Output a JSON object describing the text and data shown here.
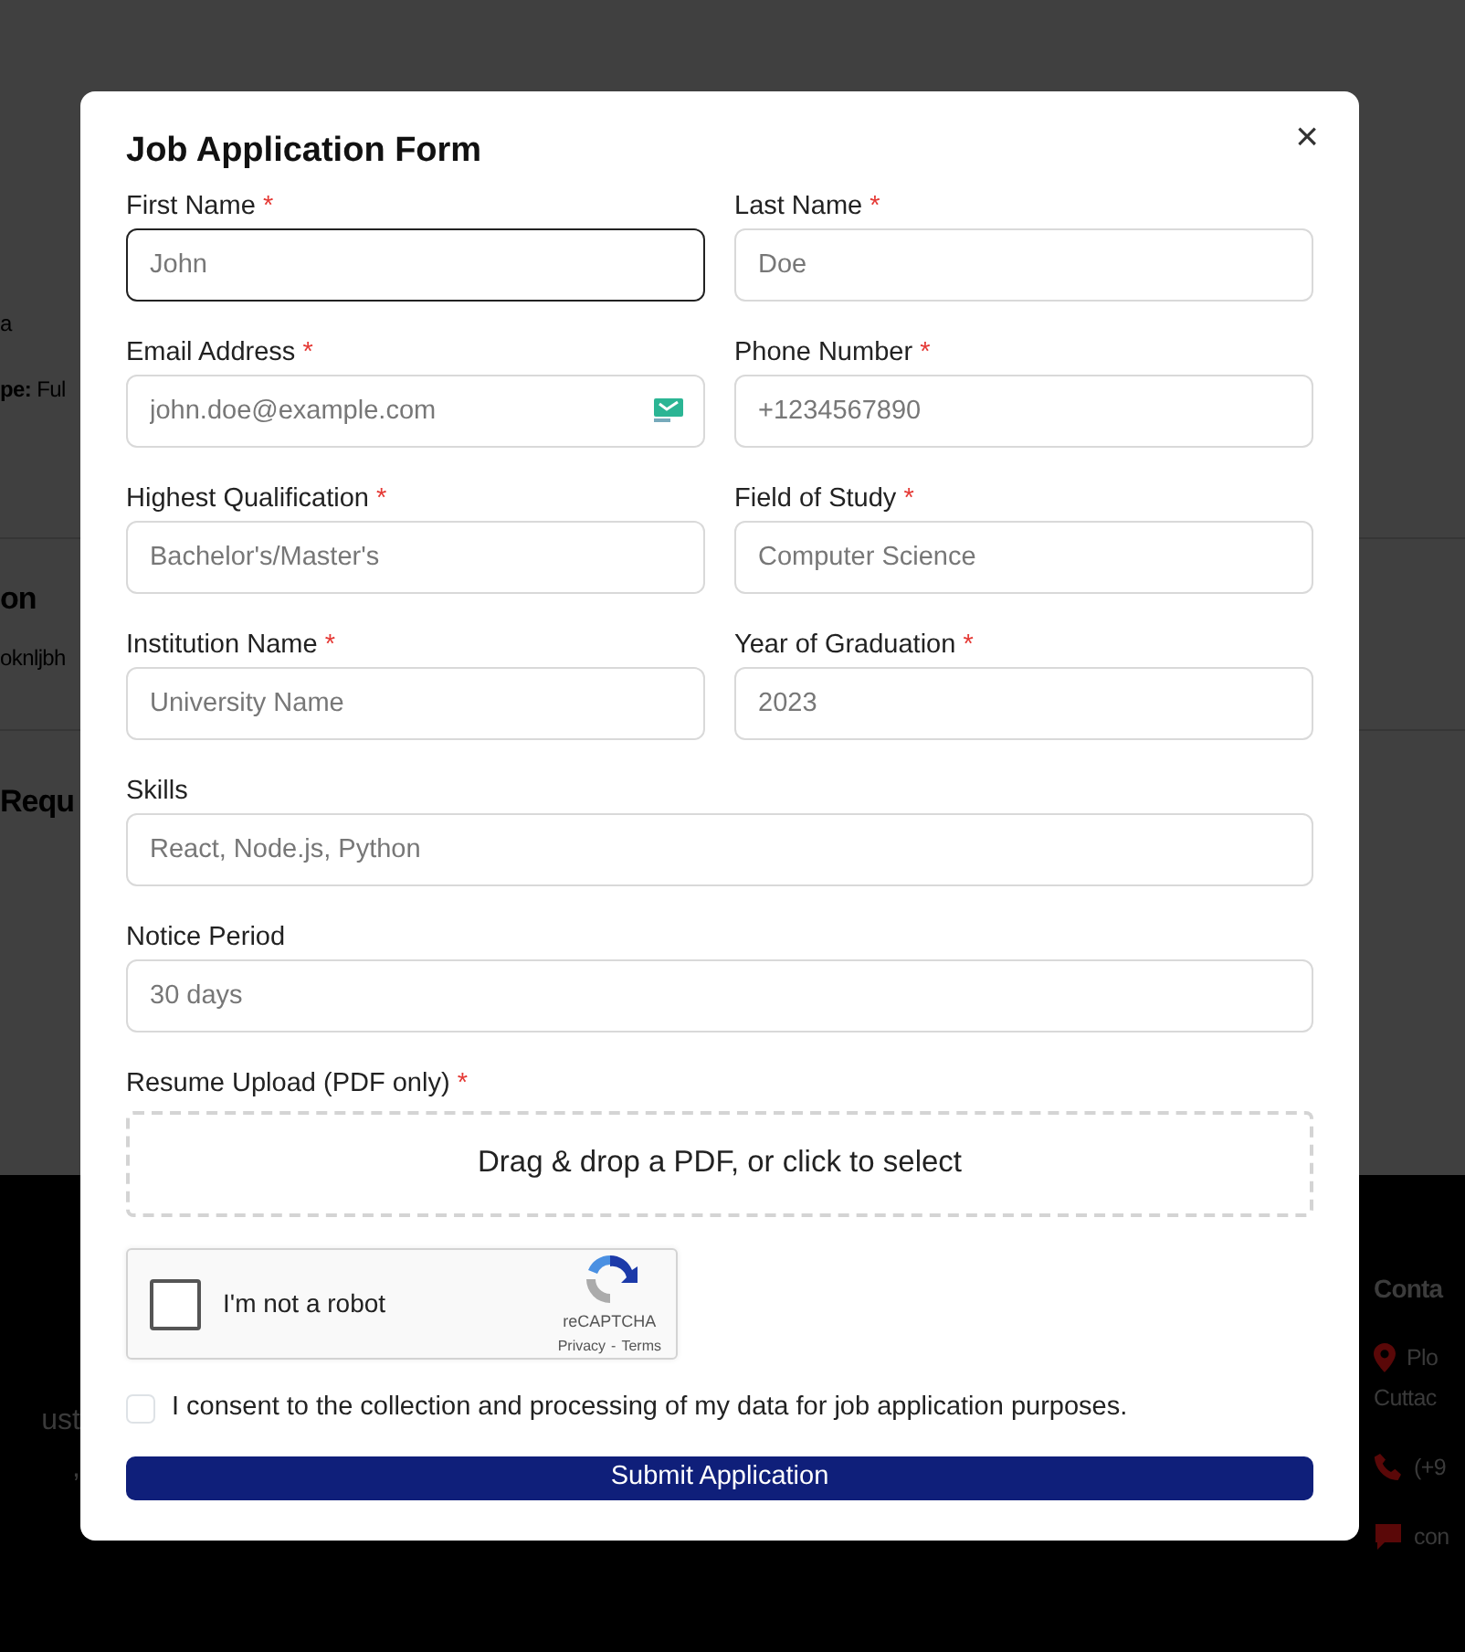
{
  "background_page": {
    "sections": [
      {
        "items": [
          {
            "kind": "text",
            "text": "a"
          },
          {
            "kind": "label_value",
            "label": "pe:",
            "value": "Ful"
          }
        ]
      },
      {
        "items": [
          {
            "kind": "heading",
            "text": "on"
          },
          {
            "kind": "text",
            "text": "oknljbh"
          }
        ]
      },
      {
        "items": [
          {
            "kind": "heading",
            "text": "Requ"
          }
        ]
      }
    ],
    "footer_left": [
      "ust",
      ","
    ],
    "contact": {
      "heading": "Conta",
      "items": [
        {
          "kind": "location",
          "lines": [
            "Plo",
            "Cuttac"
          ]
        },
        {
          "kind": "phone",
          "lines": [
            "(+9"
          ]
        },
        {
          "kind": "chat",
          "lines": [
            "con"
          ]
        }
      ]
    }
  },
  "modal": {
    "title": "Job Application Form",
    "close": "×",
    "rows": [
      [
        {
          "label": "First Name",
          "required_mark": "*",
          "placeholder": "John",
          "focused": true
        },
        {
          "label": "Last Name",
          "required_mark": "*",
          "placeholder": "Doe",
          "focused": false
        }
      ],
      [
        {
          "label": "Email Address",
          "required_mark": "*",
          "placeholder": "john.doe@example.com",
          "focused": false,
          "kind": "email"
        },
        {
          "label": "Phone Number",
          "required_mark": "*",
          "placeholder": "+1234567890",
          "focused": false
        }
      ],
      [
        {
          "label": "Highest Qualification",
          "required_mark": "*",
          "placeholder": "Bachelor's/Master's",
          "focused": false
        },
        {
          "label": "Field of Study",
          "required_mark": "*",
          "placeholder": "Computer Science",
          "focused": false
        }
      ],
      [
        {
          "label": "Institution Name",
          "required_mark": "*",
          "placeholder": "University Name",
          "focused": false
        },
        {
          "label": "Year of Graduation",
          "required_mark": "*",
          "placeholder": "2023",
          "focused": false
        }
      ],
      [
        {
          "label": "Skills",
          "placeholder": "React, Node.js, Python",
          "focused": false
        }
      ],
      [
        {
          "label": "Notice Period",
          "placeholder": "30 days",
          "focused": false
        }
      ]
    ],
    "resume": {
      "label": "Resume Upload (PDF only)",
      "required_mark": "*",
      "dropzone_text": "Drag & drop a PDF, or click to select"
    },
    "recaptcha": {
      "label": "I'm not a robot",
      "checked": false,
      "brand": "reCAPTCHA",
      "links": [
        "Privacy",
        "Terms"
      ],
      "separator": "-"
    },
    "consent": {
      "text": "I consent to the collection and processing of my data for job application purposes.",
      "checked": false
    },
    "submit": "Submit Application"
  }
}
